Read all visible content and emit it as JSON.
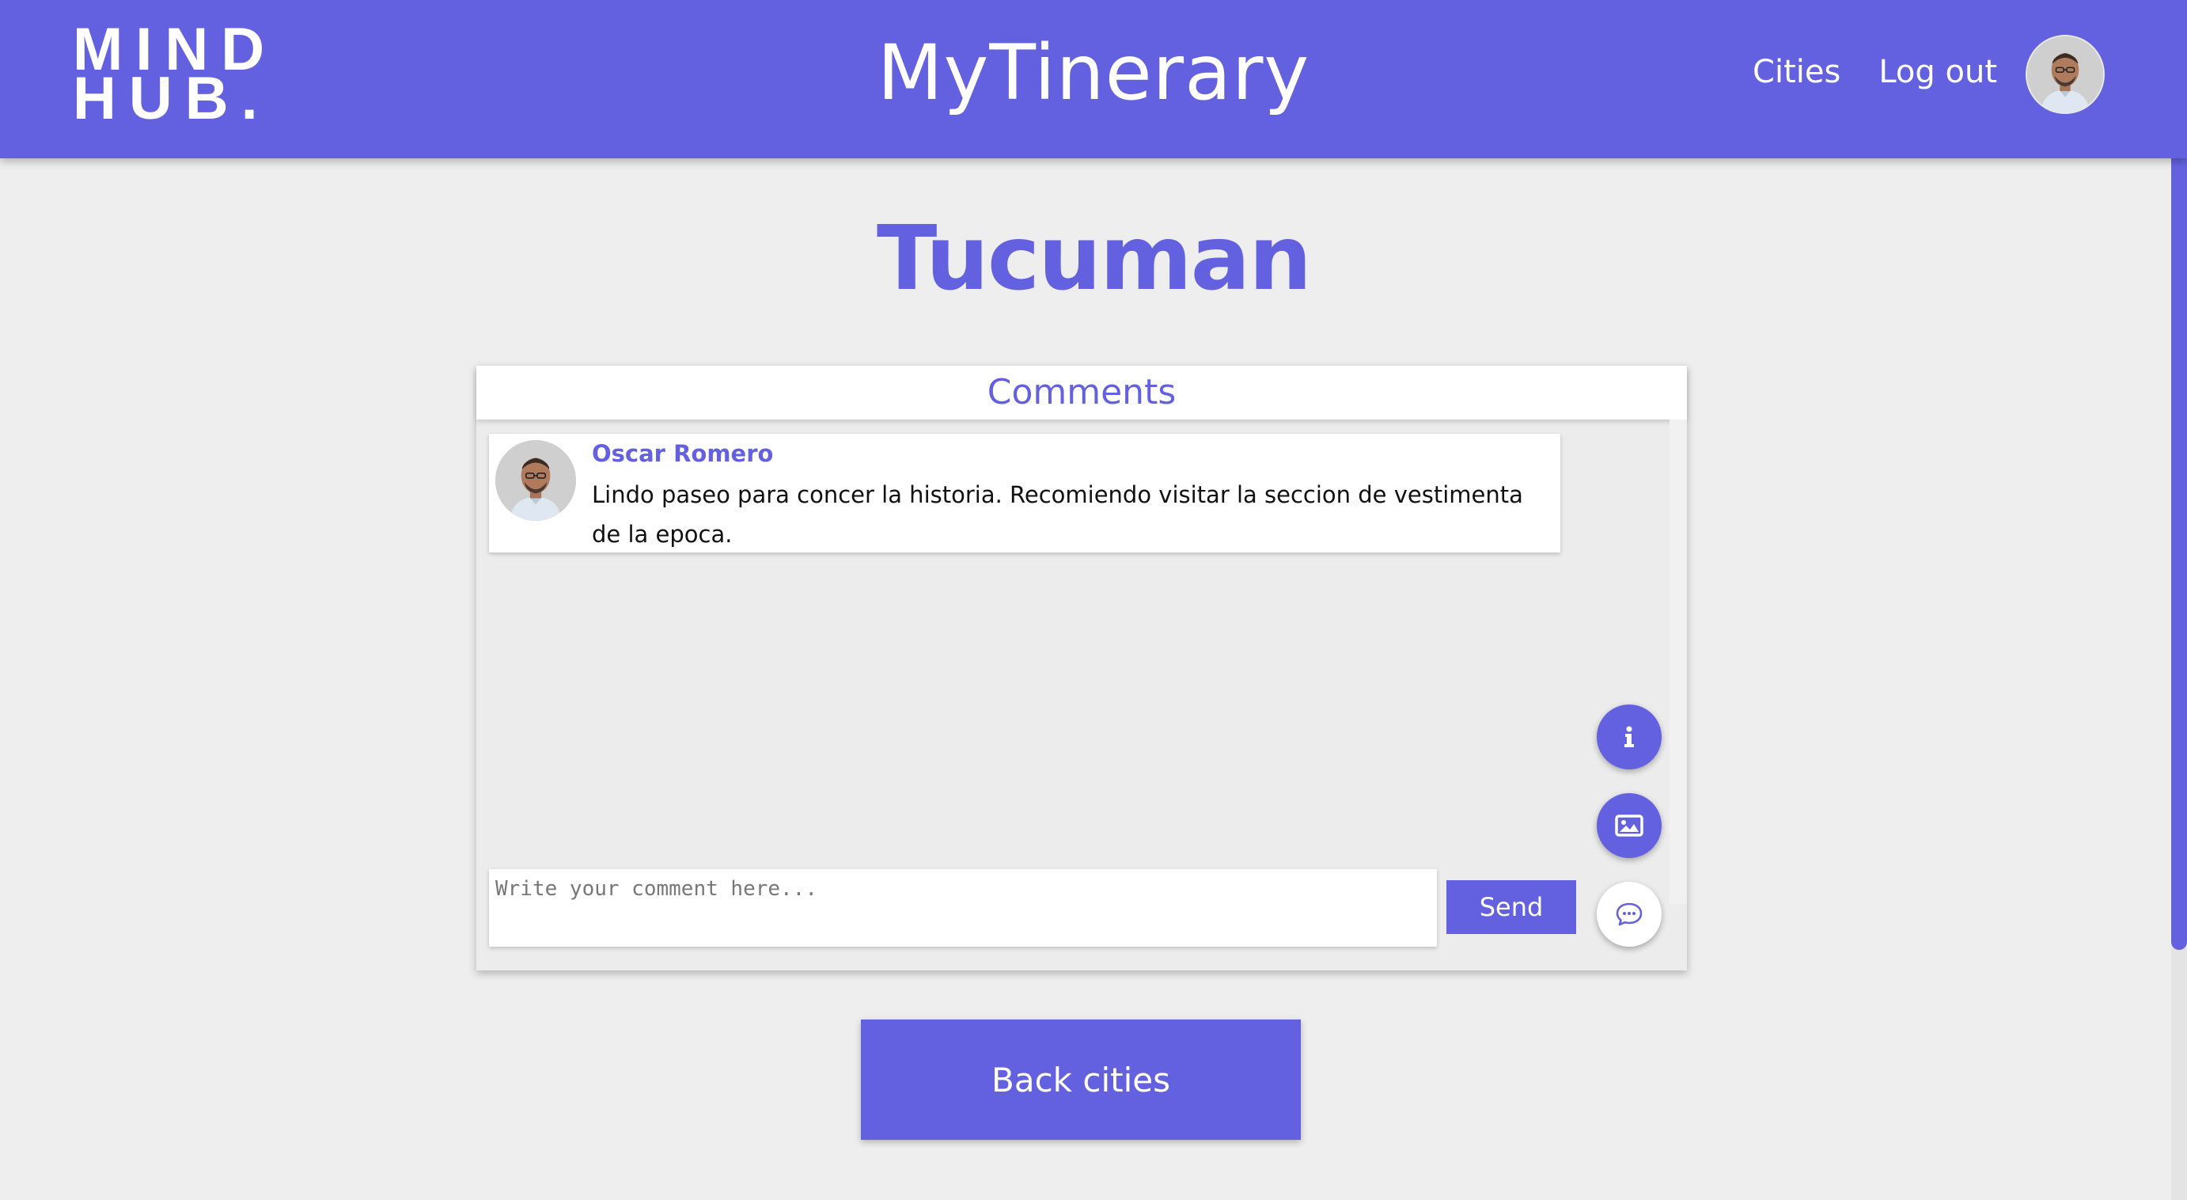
{
  "header": {
    "logo_line1": "MIND",
    "logo_line2": "HUB.",
    "app_title": "MyTinerary",
    "nav": {
      "cities": "Cities",
      "logout": "Log out"
    }
  },
  "page": {
    "city_name": "Tucuman"
  },
  "comments_panel": {
    "title": "Comments",
    "comments": [
      {
        "author": "Oscar Romero",
        "text": "Lindo paseo para concer la historia. Recomiendo visitar la seccion de vestimenta de la epoca."
      }
    ],
    "input_placeholder": "Write your comment here...",
    "send_label": "Send",
    "actions": [
      "info-icon",
      "image-icon",
      "chat-icon"
    ]
  },
  "footer": {
    "back_label": "Back cities"
  },
  "colors": {
    "accent": "#6461e0",
    "background": "#eeeeee"
  }
}
